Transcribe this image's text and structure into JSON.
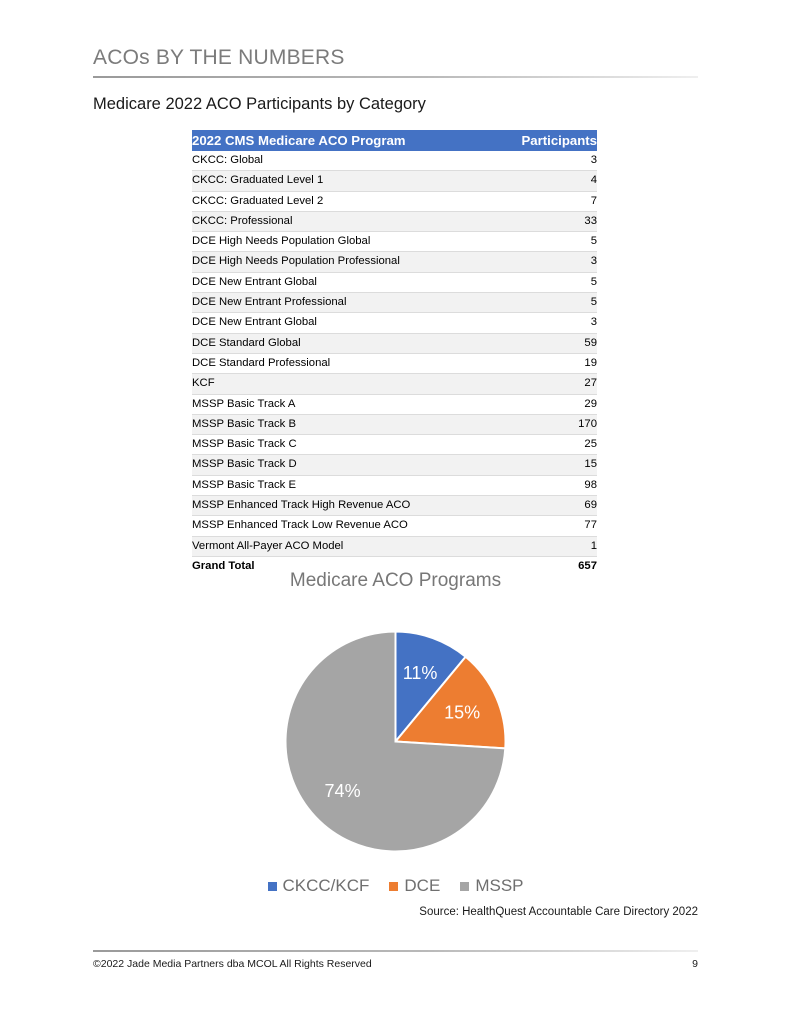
{
  "header": {
    "page_heading": "ACOs BY THE NUMBERS",
    "section_subtitle": "Medicare 2022 ACO Participants by Category"
  },
  "table": {
    "columns": [
      "2022 CMS Medicare ACO Program",
      "Participants"
    ],
    "header_bg": "#4472C4",
    "rows": [
      {
        "program": "CKCC: Global",
        "participants": "3"
      },
      {
        "program": "CKCC: Graduated Level 1",
        "participants": "4"
      },
      {
        "program": "CKCC: Graduated Level 2",
        "participants": "7"
      },
      {
        "program": "CKCC: Professional",
        "participants": "33"
      },
      {
        "program": "DCE High Needs Population Global",
        "participants": "5"
      },
      {
        "program": "DCE High Needs Population Professional",
        "participants": "3"
      },
      {
        "program": "DCE New Entrant Global",
        "participants": "5"
      },
      {
        "program": "DCE New Entrant Professional",
        "participants": "5"
      },
      {
        "program": "DCE New Entrant Global",
        "participants": "3"
      },
      {
        "program": "DCE Standard Global",
        "participants": "59"
      },
      {
        "program": "DCE Standard Professional",
        "participants": "19"
      },
      {
        "program": "KCF",
        "participants": "27"
      },
      {
        "program": "MSSP Basic Track A",
        "participants": "29"
      },
      {
        "program": "MSSP Basic Track B",
        "participants": "170"
      },
      {
        "program": "MSSP Basic Track C",
        "participants": "25"
      },
      {
        "program": "MSSP Basic Track D",
        "participants": "15"
      },
      {
        "program": "MSSP Basic Track E",
        "participants": "98"
      },
      {
        "program": "MSSP Enhanced Track High Revenue ACO",
        "participants": "69"
      },
      {
        "program": "MSSP Enhanced Track Low Revenue ACO",
        "participants": "77"
      },
      {
        "program": "Vermont All-Payer ACO Model",
        "participants": "1"
      }
    ],
    "total": {
      "program": "Grand Total",
      "participants": "657"
    }
  },
  "chart_data": {
    "type": "pie",
    "title": "Medicare ACO Programs",
    "categories": [
      "CKCC/KCF",
      "DCE",
      "MSSP"
    ],
    "values": [
      11,
      15,
      74
    ],
    "value_labels": [
      "11%",
      "15%",
      "74%"
    ],
    "colors": [
      "#4472C4",
      "#ED7D31",
      "#A5A5A5"
    ],
    "legend_position": "bottom",
    "grid": false,
    "source": "Source:  HealthQuest Accountable Care Directory 2022"
  },
  "footer": {
    "copyright": "©2022 Jade Media Partners dba MCOL All Rights Reserved",
    "page_number": "9"
  }
}
